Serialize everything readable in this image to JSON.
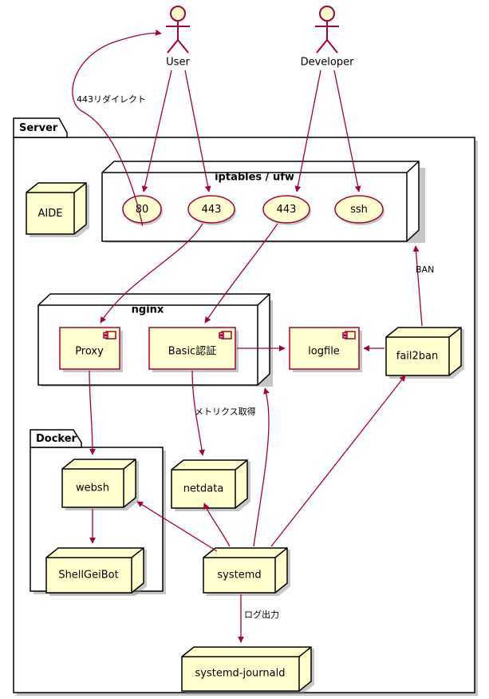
{
  "diagram": {
    "type": "plantuml-deployment-diagram",
    "title": "",
    "accent_color": "#A80036",
    "node_fill": "#FEFECE",
    "frame_fill": "#FFFFFF",
    "stroke_color": "#000000"
  },
  "actors": [
    {
      "id": "user",
      "label": "User"
    },
    {
      "id": "developer",
      "label": "Developer"
    }
  ],
  "frames": [
    {
      "id": "server",
      "label": "Server"
    },
    {
      "id": "docker",
      "label": "Docker"
    }
  ],
  "packages": [
    {
      "id": "iptables",
      "label": "iptables / ufw"
    },
    {
      "id": "nginx",
      "label": "nginx"
    }
  ],
  "ports": [
    {
      "id": "port80",
      "label": "80"
    },
    {
      "id": "port443a",
      "label": "443"
    },
    {
      "id": "port443b",
      "label": "443"
    },
    {
      "id": "portssh",
      "label": "ssh"
    }
  ],
  "components": [
    {
      "id": "proxy",
      "label": "Proxy"
    },
    {
      "id": "basicauth",
      "label": "Basic認証"
    },
    {
      "id": "logfile",
      "label": "logfile"
    }
  ],
  "nodes": [
    {
      "id": "aide",
      "label": "AIDE"
    },
    {
      "id": "fail2ban",
      "label": "fail2ban"
    },
    {
      "id": "websh",
      "label": "websh"
    },
    {
      "id": "netdata",
      "label": "netdata"
    },
    {
      "id": "shellgeibot",
      "label": "ShellGeiBot"
    },
    {
      "id": "systemd",
      "label": "systemd"
    },
    {
      "id": "systemdjournald",
      "label": "systemd-journald"
    }
  ],
  "edge_labels": [
    {
      "id": "redirect443",
      "label": "443リダイレクト"
    },
    {
      "id": "ban",
      "label": "BAN"
    },
    {
      "id": "metrics",
      "label": "メトリクス取得"
    },
    {
      "id": "logout",
      "label": "ログ出力"
    }
  ]
}
